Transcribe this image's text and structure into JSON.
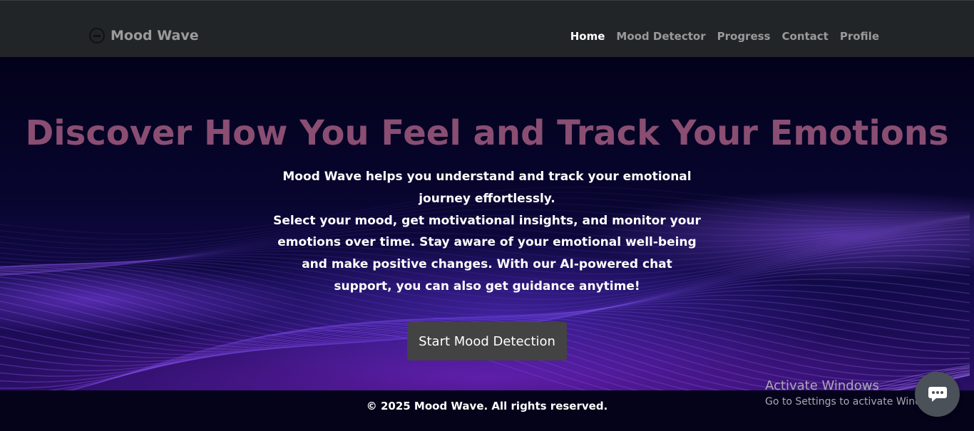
{
  "nav": {
    "brand": "Mood Wave",
    "links": [
      "Home",
      "Mood Detector",
      "Progress",
      "Contact",
      "Profile"
    ]
  },
  "hero": {
    "title": "Discover How You Feel and Track Your Emotions",
    "desc_line1": "Mood Wave helps you understand and track your emotional journey effortlessly.",
    "desc_line2": "Select your mood, get motivational insights, and monitor your emotions over time. Stay aware of your emotional well-being and make positive changes. With our AI-powered chat support, you can also get guidance anytime!",
    "cta": "Start Mood Detection"
  },
  "footer": {
    "text": "© 2025 Mood Wave. All rights reserved."
  },
  "watermark": {
    "title": "Activate Windows",
    "subtitle": "Go to Settings to activate Windows."
  },
  "icons": {
    "brand": "circle-minus-icon",
    "chat": "chat-bubble-icon"
  },
  "colors": {
    "title": "#8a4e72",
    "cta_bg": "#434343",
    "nav_bg": "#222527"
  }
}
